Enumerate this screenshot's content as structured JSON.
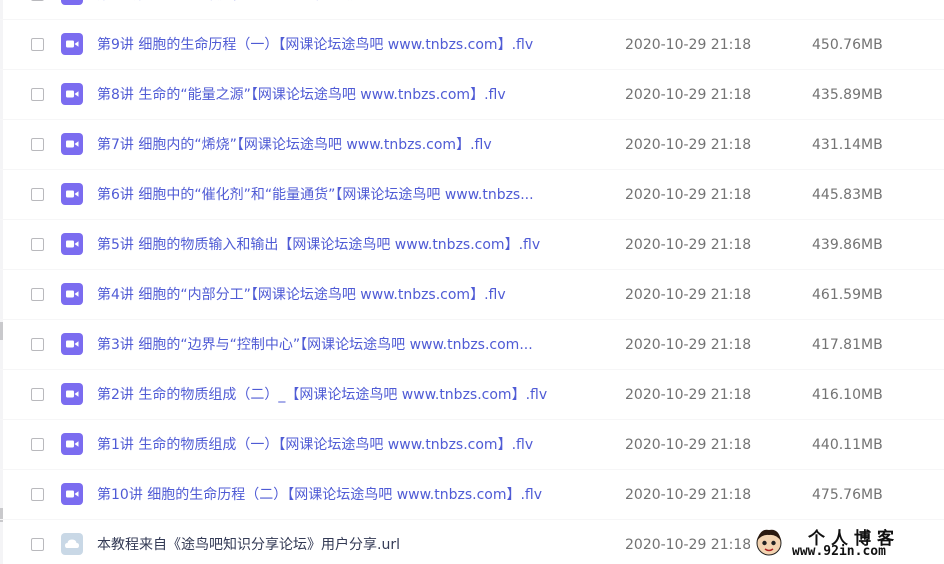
{
  "files": [
    {
      "name": "第10讲 细胞的生命历程（二）【网课论坛途鸟吧 www.tnbzs.com】.flv",
      "date": "2020-10-29 21:18",
      "size": "475.76MB",
      "type": "video",
      "partial": true
    },
    {
      "name": "第9讲 细胞的生命历程（一）【网课论坛途鸟吧 www.tnbzs.com】.flv",
      "date": "2020-10-29 21:18",
      "size": "450.76MB",
      "type": "video"
    },
    {
      "name": "第8讲  生命的“能量之源”【网课论坛途鸟吧 www.tnbzs.com】.flv",
      "date": "2020-10-29 21:18",
      "size": "435.89MB",
      "type": "video"
    },
    {
      "name": "第7讲 细胞内的“烯烧”【网课论坛途鸟吧 www.tnbzs.com】.flv",
      "date": "2020-10-29 21:18",
      "size": "431.14MB",
      "type": "video"
    },
    {
      "name": "第6讲 细胞中的“催化剂”和“能量通货”【网课论坛途鸟吧 www.tnbzs...",
      "date": "2020-10-29 21:18",
      "size": "445.83MB",
      "type": "video"
    },
    {
      "name": "第5讲 细胞的物质输入和输出【网课论坛途鸟吧 www.tnbzs.com】.flv",
      "date": "2020-10-29 21:18",
      "size": "439.86MB",
      "type": "video"
    },
    {
      "name": "第4讲 细胞的“内部分工”【网课论坛途鸟吧 www.tnbzs.com】.flv",
      "date": "2020-10-29 21:18",
      "size": "461.59MB",
      "type": "video"
    },
    {
      "name": "第3讲 细胞的“边界与“控制中心”【网课论坛途鸟吧 www.tnbzs.com...",
      "date": "2020-10-29 21:18",
      "size": "417.81MB",
      "type": "video"
    },
    {
      "name": "第2讲 生命的物质组成（二）_【网课论坛途鸟吧 www.tnbzs.com】.flv",
      "date": "2020-10-29 21:18",
      "size": "416.10MB",
      "type": "video"
    },
    {
      "name": "第1讲 生命的物质组成（一）【网课论坛途鸟吧 www.tnbzs.com】.flv",
      "date": "2020-10-29 21:18",
      "size": "440.11MB",
      "type": "video"
    },
    {
      "name": "第10讲 细胞的生命历程（二）【网课论坛途鸟吧 www.tnbzs.com】.flv",
      "date": "2020-10-29 21:18",
      "size": "475.76MB",
      "type": "video"
    },
    {
      "name": "本教程来自《途鸟吧知识分享论坛》用户分享.url",
      "date": "2020-10-29 21:18",
      "size": "",
      "type": "link"
    }
  ],
  "watermark": {
    "title": "个人博客",
    "url": "www.92in.com"
  },
  "colors": {
    "accent": "#4f5bd5",
    "video_icon": "#7b6cf0",
    "meta_text": "#737373"
  },
  "icons": {
    "video": "video-file-icon",
    "link": "link-file-icon"
  }
}
